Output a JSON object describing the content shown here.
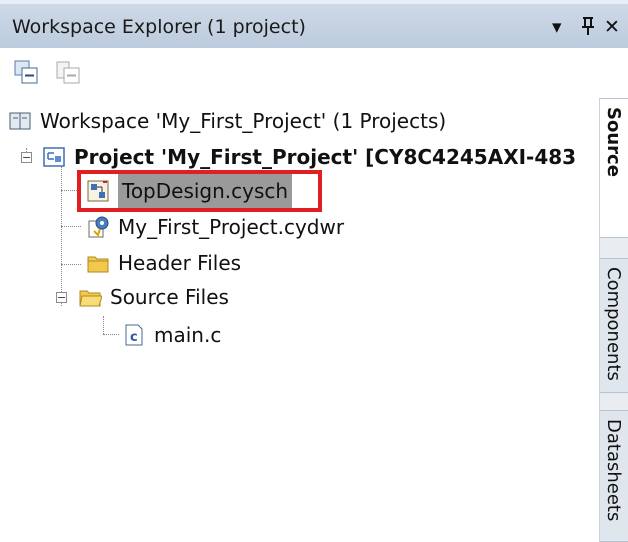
{
  "panel": {
    "title": "Workspace Explorer (1 project)",
    "controls": [
      "▾",
      "ᵖ",
      "✕"
    ]
  },
  "tree": {
    "workspace": "Workspace 'My_First_Project' (1 Projects)",
    "project": "Project  'My_First_Project' [CY8C4245AXI-483",
    "items": {
      "topdesign": "TopDesign.cysch",
      "cydwr": "My_First_Project.cydwr",
      "header_files": "Header Files",
      "source_files": "Source Files",
      "main": "main.c"
    }
  },
  "tabs": [
    "Source",
    "Components",
    "Datasheets"
  ]
}
